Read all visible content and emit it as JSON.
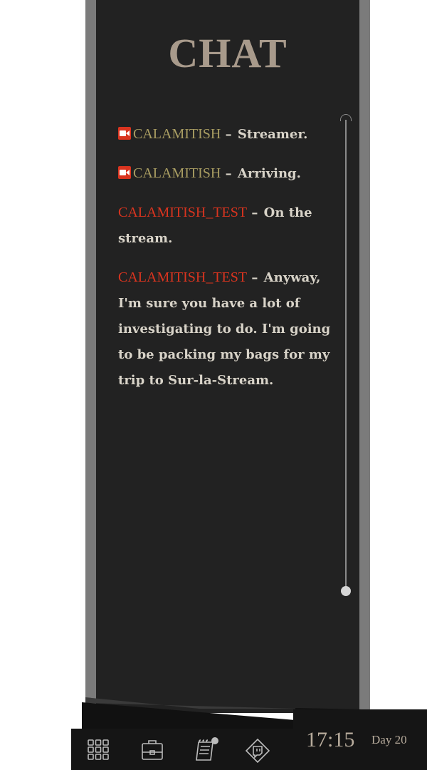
{
  "panel": {
    "title": "CHAT"
  },
  "messages": [
    {
      "author": "CALAMITISH",
      "role": "streamer",
      "icon": "camera-icon",
      "separator": "–",
      "text": "Streamer."
    },
    {
      "author": "CALAMITISH",
      "role": "streamer",
      "icon": "camera-icon",
      "separator": "–",
      "text": "Arriving."
    },
    {
      "author": "CALAMITISH_TEST",
      "role": "viewer",
      "separator": "–",
      "text": "On the stream."
    },
    {
      "author": "CALAMITISH_TEST",
      "role": "viewer",
      "separator": "–",
      "text": "Anyway, I'm sure you have a lot of investigating to do. I'm going to be packing my bags for my trip to Sur-la-Stream."
    }
  ],
  "bottom_bar": {
    "time": "17:15",
    "day": "Day 20",
    "nav_icons": [
      "grid-icon",
      "briefcase-icon",
      "notebook-icon",
      "stream-diamond-icon"
    ]
  },
  "colors": {
    "panel_bg": "#222222",
    "panel_frame": "#7b7b7b",
    "title": "#a89a8b",
    "streamer_name": "#a99d62",
    "viewer_name": "#d9341f",
    "message_text": "#d8d3c8",
    "bar_bg": "#151515"
  }
}
